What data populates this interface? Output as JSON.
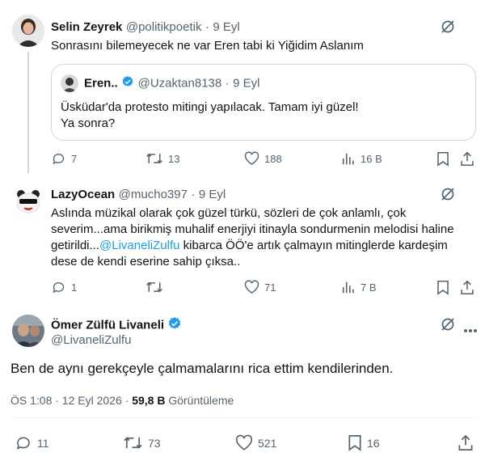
{
  "tweet1": {
    "display_name": "Selin Zeyrek",
    "handle": "@politikpoetik",
    "separator": "·",
    "date": "9 Eyl",
    "text": "Sonrasını bilemeyecek ne var Eren tabi ki Yiğidim Aslanım",
    "quote": {
      "display_name": "Eren..",
      "handle": "@Uzaktan8138",
      "separator": "·",
      "date": "9 Eyl",
      "text_line1": "Üsküdar'da protesto mitingi yapılacak. Tamam iyi güzel!",
      "text_line2": "Ya sonra?"
    },
    "actions": {
      "replies": "7",
      "retweets": "13",
      "likes": "188",
      "views": "16 B"
    }
  },
  "tweet2": {
    "display_name": "LazyOcean",
    "handle": "@mucho397",
    "separator": "·",
    "date": "9 Eyl",
    "line1": "Aslında müzikal olarak çok güzel türkü, sözleri de çok anlamlı, çok",
    "line2": "severim...ama birikmiş muhalif enerjiyi itinayla sondurmenin melodisi haline",
    "line3_pre": "getirildi...",
    "line3_mention": "@LivaneliZulfu",
    "line3_post": " kibarca ÖÖ'e artık çalmayın mitinglerde kardeşim",
    "line4": "dese de kendi eserine sahip çıksa..",
    "actions": {
      "replies": "1",
      "retweets": "",
      "likes": "71",
      "views": "7 B"
    }
  },
  "tweet3": {
    "display_name": "Ömer Zülfü Livaneli",
    "handle": "@LivaneliZulfu",
    "text": "Ben de aynı gerekçeyle çalmamalarını rica ettim kendilerinden.",
    "timestamp": "ÖS 1:08 · 12 Eyl 2026 ·",
    "views_count": "59,8 B",
    "views_label": "Görüntüleme",
    "actions": {
      "replies": "11",
      "retweets": "73",
      "likes": "521",
      "bookmarks": "16"
    }
  },
  "colors": {
    "accent": "#1d9bf0",
    "muted": "#536471",
    "text": "#0f1419",
    "line": "#cfd9de"
  }
}
